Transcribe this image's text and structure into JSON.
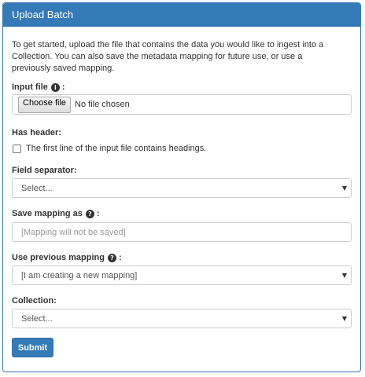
{
  "panel": {
    "title": "Upload Batch",
    "intro": "To get started, upload the file that contains the data you would like to ingest into a Collection. You can also save the metadata mapping for future use, or use a previously saved mapping."
  },
  "input_file": {
    "label": "Input file",
    "label_suffix": ":",
    "button_label": "Choose file",
    "status": "No file chosen",
    "help_icon": "info-icon"
  },
  "has_header": {
    "label": "Has header:",
    "checkbox_label": "The first line of the input file contains headings.",
    "checked": false
  },
  "field_separator": {
    "label": "Field separator:",
    "selected": "Select..."
  },
  "save_mapping": {
    "label": "Save mapping as",
    "label_suffix": ":",
    "placeholder": "[Mapping will not be saved]",
    "value": "",
    "help_icon": "question-icon"
  },
  "previous_mapping": {
    "label": "Use previous mapping",
    "label_suffix": ":",
    "selected": "[I am creating a new mapping]",
    "help_icon": "question-icon"
  },
  "collection": {
    "label": "Collection:",
    "selected": "Select..."
  },
  "submit_label": "Submit",
  "colors": {
    "primary": "#337ab7",
    "border": "#cccccc"
  },
  "icons": {
    "info_glyph": "i",
    "question_glyph": "?",
    "caret_glyph": "▼"
  }
}
